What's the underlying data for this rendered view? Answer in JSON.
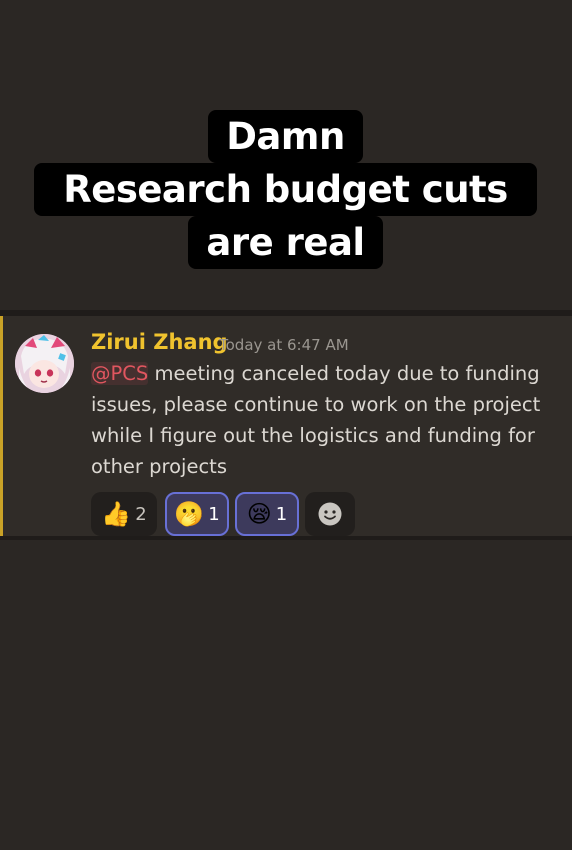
{
  "caption": {
    "line1": "Damn",
    "line2": "Research budget cuts",
    "line3": "are real"
  },
  "message": {
    "username": "Zirui Zhang",
    "username_color": "#f0c32e",
    "timestamp": "Today at 6:47 AM",
    "mention": "@PCS",
    "text": " meeting canceled today due to funding issues, please continue to work on the project while I figure out the logistics and funding for other projects",
    "highlight_color": "#c9a227",
    "reactions": [
      {
        "icon": "thumbs-up-icon",
        "emoji": "👍",
        "count": "2",
        "active": false
      },
      {
        "icon": "face-with-open-eyes-hand-over-mouth-icon",
        "emoji": "🫢",
        "count": "1",
        "active": true
      },
      {
        "icon": "sleepy-face-icon",
        "emoji": "😪",
        "count": "1",
        "active": true
      },
      {
        "icon": "add-reaction-smiley-icon",
        "emoji": "☻",
        "count": "",
        "active": false
      }
    ]
  }
}
